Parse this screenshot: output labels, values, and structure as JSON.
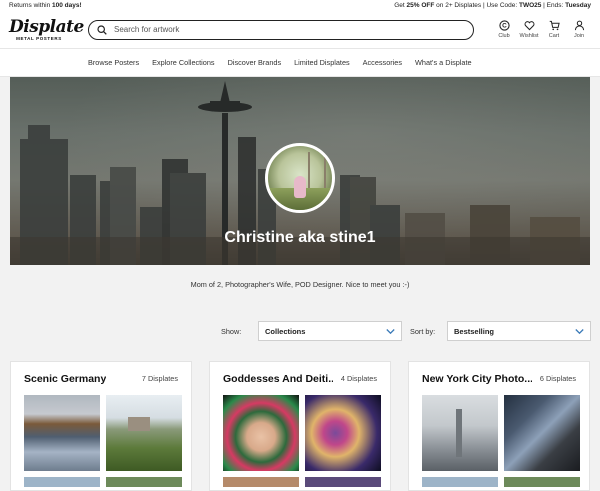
{
  "topbar": {
    "left_prefix": "Returns within ",
    "left_bold": "100 days!",
    "promo_prefix": "Get ",
    "promo_bold": "25% OFF",
    "promo_mid": " on 2+ Displates | Use Code: ",
    "promo_code": "TWO25",
    "promo_ends": " | Ends: ",
    "promo_day": "Tuesday"
  },
  "header": {
    "logo_word": "Displate",
    "logo_sub": "METAL POSTERS",
    "search_placeholder": "Search for artwork",
    "icons": [
      {
        "name": "club-icon",
        "label": "Club"
      },
      {
        "name": "heart-icon",
        "label": "Wishlist"
      },
      {
        "name": "cart-icon",
        "label": "Cart"
      },
      {
        "name": "user-icon",
        "label": "Join"
      }
    ]
  },
  "nav": {
    "items": [
      "Browse Posters",
      "Explore Collections",
      "Discover Brands",
      "Limited Displates",
      "Accessories",
      "What's a Displate"
    ]
  },
  "profile": {
    "name": "Christine aka stine1",
    "bio": "Mom of 2, Photographer's Wife, POD Designer. Nice to meet you :-)"
  },
  "filters": {
    "show_label": "Show:",
    "show_value": "Collections",
    "sort_label": "Sort by:",
    "sort_value": "Bestselling"
  },
  "collections": [
    {
      "title": "Scenic Germany",
      "count": "7 Displates"
    },
    {
      "title": "Goddesses And Deiti...",
      "count": "4 Displates"
    },
    {
      "title": "New York City Photo...",
      "count": "6 Displates"
    }
  ]
}
